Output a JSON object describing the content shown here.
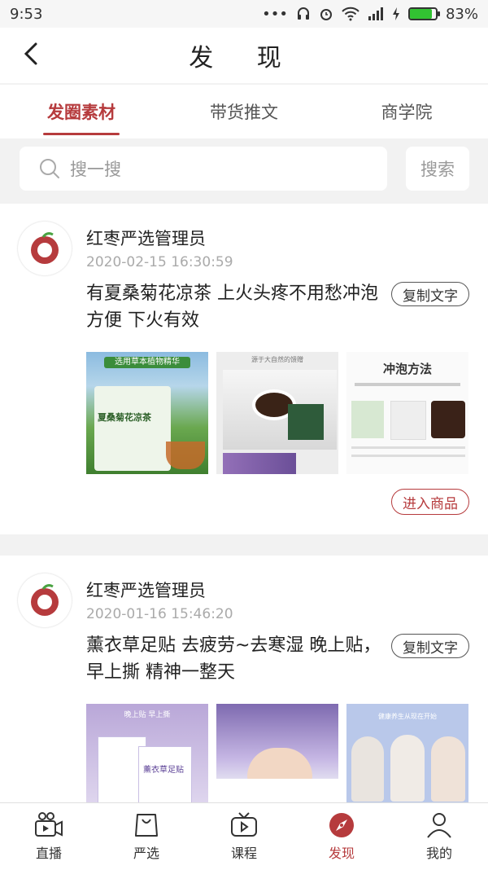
{
  "status_bar": {
    "time": "9:53",
    "battery": "83%",
    "battery_level": 0.83
  },
  "app_bar": {
    "title": "发 现"
  },
  "tabs": [
    {
      "label": "发圈素材",
      "active": true
    },
    {
      "label": "带货推文",
      "active": false
    },
    {
      "label": "商学院",
      "active": false
    }
  ],
  "search": {
    "placeholder": "搜一搜",
    "button": "搜索"
  },
  "posts": [
    {
      "author": "红枣严选管理员",
      "time": "2020-02-15 16:30:59",
      "text": "有夏桑菊花凉茶 上火头疼不用愁冲泡方便 下火有效",
      "copy_label": "复制文字",
      "goods_label": "进入商品",
      "thumbs": [
        {
          "caption": "选用草本植物精华",
          "label": "夏桑菊花凉茶"
        },
        {
          "caption": "源于大自然的馈赠",
          "label": ""
        },
        {
          "caption": "冲泡方法",
          "label": ""
        }
      ]
    },
    {
      "author": "红枣严选管理员",
      "time": "2020-01-16 15:46:20",
      "text": "薰衣草足贴 去疲劳~去寒湿 晚上贴，早上撕 精神一整天",
      "copy_label": "复制文字",
      "thumbs": [
        {
          "caption": "晚上贴 早上撕",
          "label": "薰衣草足贴"
        },
        {
          "caption": "",
          "label": ""
        },
        {
          "caption": "健康养生从现在开始",
          "label": ""
        }
      ]
    }
  ],
  "bottom_nav": [
    {
      "label": "直播",
      "icon": "live-camera-icon",
      "active": false
    },
    {
      "label": "严选",
      "icon": "shopping-bag-icon",
      "active": false
    },
    {
      "label": "课程",
      "icon": "tv-play-icon",
      "active": false
    },
    {
      "label": "发现",
      "icon": "compass-icon",
      "active": true
    },
    {
      "label": "我的",
      "icon": "user-icon",
      "active": false
    }
  ],
  "colors": {
    "accent": "#b63b3d",
    "bg": "#f2f2f2"
  }
}
